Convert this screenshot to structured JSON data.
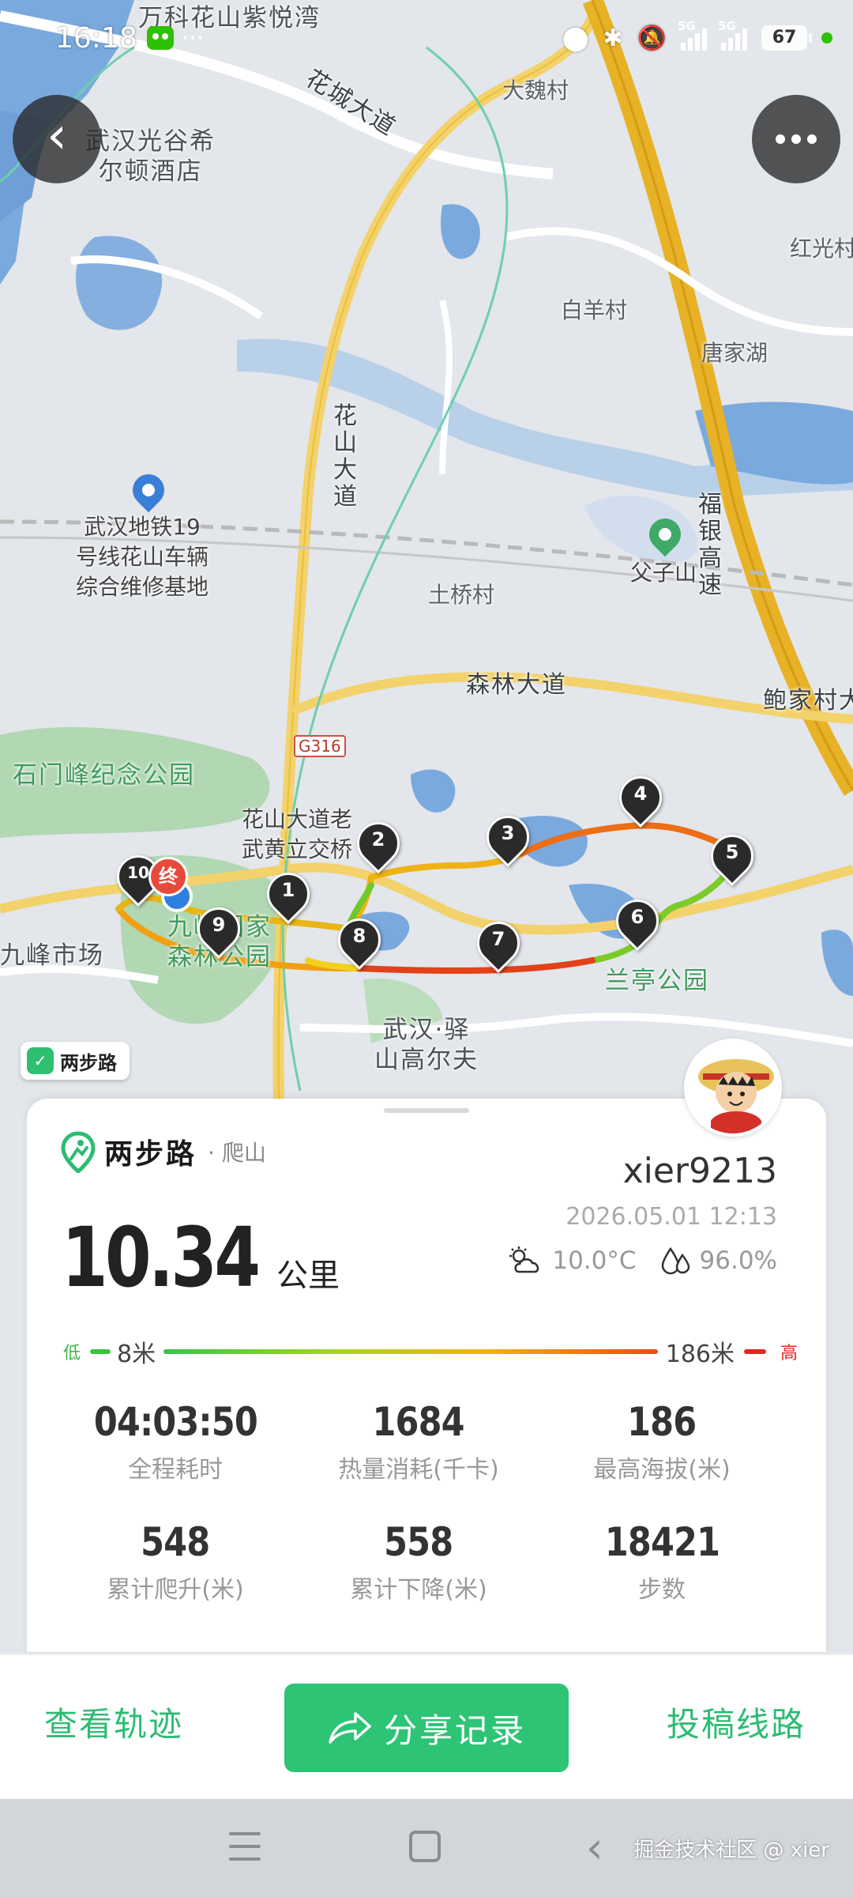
{
  "status_bar": {
    "time": "16:18",
    "signal_1_label": "5G",
    "signal_2_label": "5G",
    "battery": "67"
  },
  "map": {
    "labels": {
      "wanke": "万科花山紫悦湾",
      "huacheng_ave": "花城大道",
      "daweicun": "大魏村",
      "hotel": "武汉光谷希\n尔顿酒店",
      "hongguang": "红光村",
      "baiyangcun": "白羊村",
      "tangjiahu": "唐家湖",
      "huashan_ave": "花\n山\n大\n道",
      "metro_depot": "武汉地铁19\n号线花山车辆\n综合维修基地",
      "fuyin_expy": "福\n银\n高\n速",
      "fuzishan": "父子山",
      "tuqiaocun": "土桥村",
      "senlin_ave": "森林大道",
      "baojiacun": "鲍家村大",
      "g316": "G316",
      "shimenfeng": "石门峰纪念公园",
      "interchange": "花山大道老\n武黄立交桥",
      "forest_park": "九峰国家\n森林公园",
      "jiufeng_market": "九峰市场",
      "lanting_park": "兰亭公园",
      "golf": "武汉·驿\n山高尔夫",
      "brand_badge": "两步路"
    },
    "markers": [
      "1",
      "2",
      "3",
      "4",
      "5",
      "6",
      "7",
      "8",
      "9",
      "10"
    ],
    "end_label": "终"
  },
  "card": {
    "logo_text": "两步路",
    "activity_type": "· 爬山",
    "username": "xier9213",
    "datetime": "2026.05.01 12:13",
    "distance_value": "10.34",
    "distance_unit": "公里",
    "temperature": "10.0°C",
    "humidity": "96.0%",
    "elevation": {
      "low_label": "低",
      "min": "8米",
      "max": "186米",
      "high_label": "高"
    },
    "stats": [
      {
        "value": "04:03:50",
        "label": "全程耗时"
      },
      {
        "value": "1684",
        "label": "热量消耗(千卡)"
      },
      {
        "value": "186",
        "label": "最高海拔(米)"
      },
      {
        "value": "548",
        "label": "累计爬升(米)"
      },
      {
        "value": "558",
        "label": "累计下降(米)"
      },
      {
        "value": "18421",
        "label": "步数"
      }
    ]
  },
  "actions": {
    "view_track": "查看轨迹",
    "share": "分享记录",
    "submit_route": "投稿线路"
  },
  "watermark": "掘金技术社区 @ xier",
  "colors": {
    "brand_green": "#2dc476",
    "track_low": "#33c848",
    "track_high": "#ec4a16"
  }
}
